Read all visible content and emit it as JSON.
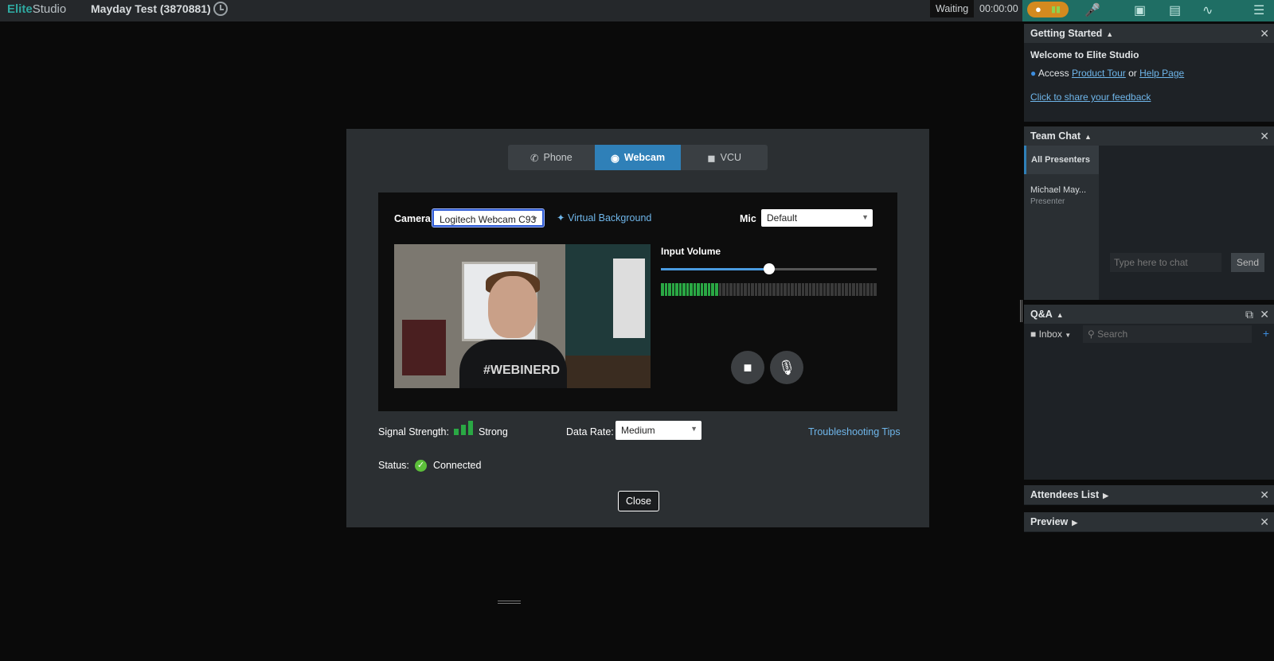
{
  "app": {
    "brand_part1": "Elite",
    "brand_part2": "Studio",
    "event_title": "Mayday Test (3870881)",
    "status": "Waiting",
    "timer": "00:00:00"
  },
  "modal": {
    "tabs": [
      {
        "label": "Phone",
        "icon": "phone-icon"
      },
      {
        "label": "Webcam",
        "icon": "webcam-icon"
      },
      {
        "label": "VCU",
        "icon": "video-camera-icon"
      }
    ],
    "camera_label": "Camera",
    "camera_value": "Logitech Webcam C93",
    "virtual_bg": "Virtual Background",
    "mic_label": "Mic",
    "mic_value": "Default",
    "video_shirt_text": "#WEBINERD",
    "input_volume_label": "Input Volume",
    "input_volume_level": 0.5,
    "meter_level": 0.26,
    "signal_label": "Signal Strength:",
    "signal_value": "Strong",
    "data_rate_label": "Data Rate:",
    "data_rate_value": "Medium",
    "troubleshooting": "Troubleshooting Tips",
    "status_label": "Status:",
    "status_value": "Connected",
    "close_label": "Close"
  },
  "panels": {
    "getting_started": {
      "title": "Getting Started",
      "welcome": "Welcome to Elite Studio",
      "access": "Access",
      "tour": "Product Tour",
      "or": "or",
      "help": "Help Page",
      "feedback": "Click to share your feedback"
    },
    "team_chat": {
      "title": "Team Chat",
      "tab": "All Presenters",
      "member_name": "Michael May...",
      "member_role": "Presenter",
      "placeholder": "Type here to chat",
      "send": "Send"
    },
    "qa": {
      "title": "Q&A",
      "inbox": "Inbox",
      "search_placeholder": "Search"
    },
    "attendees": {
      "title": "Attendees List"
    },
    "preview": {
      "title": "Preview"
    }
  },
  "colors": {
    "accent": "#2f80b8",
    "link": "#6fb6ea",
    "success": "#2aa844",
    "brand": "#2fa8a0"
  }
}
